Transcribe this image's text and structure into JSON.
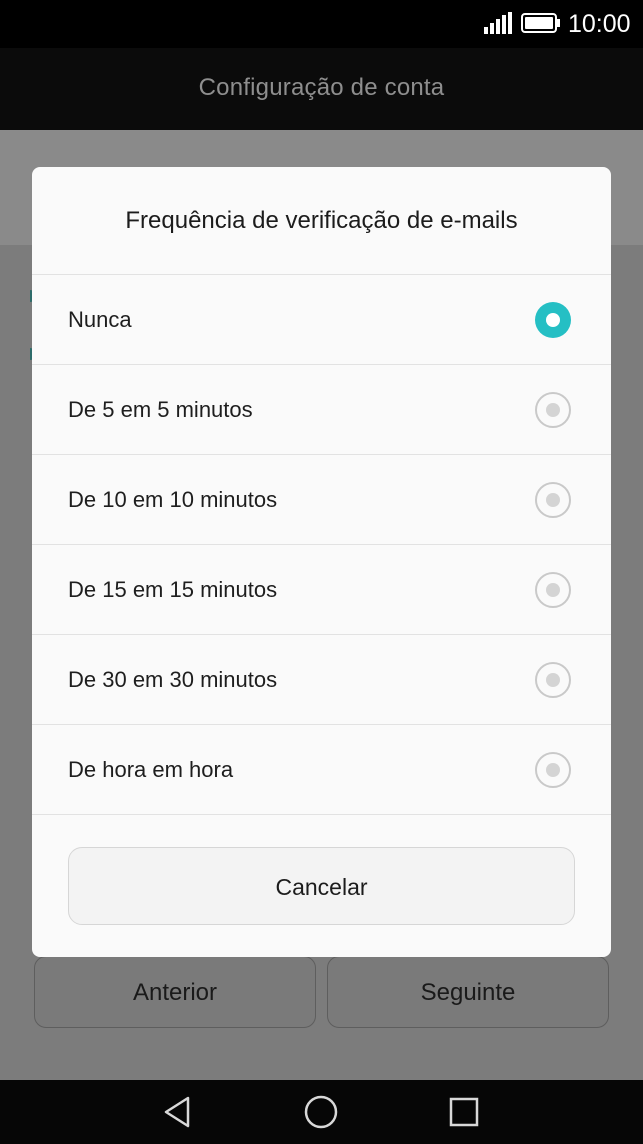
{
  "status_bar": {
    "time": "10:00",
    "icons": [
      "signal-icon",
      "battery-icon"
    ]
  },
  "title_bar": {
    "title": "Configuração de conta"
  },
  "dialog": {
    "title": "Frequência de verificação de e-mails",
    "options": [
      {
        "label": "Nunca",
        "selected": true
      },
      {
        "label": "De 5 em 5 minutos",
        "selected": false
      },
      {
        "label": "De 10 em 10 minutos",
        "selected": false
      },
      {
        "label": "De 15 em 15 minutos",
        "selected": false
      },
      {
        "label": "De 30 em 30 minutos",
        "selected": false
      },
      {
        "label": "De hora em hora",
        "selected": false
      }
    ],
    "cancel_label": "Cancelar"
  },
  "background_buttons": {
    "previous_label": "Anterior",
    "next_label": "Seguinte"
  },
  "nav_bar": {
    "icons": [
      "back-icon",
      "home-icon",
      "recent-apps-icon"
    ]
  },
  "colors": {
    "accent": "#25bfc4",
    "dialog_background": "#fafafa",
    "scrim": "#7a7a7a"
  }
}
